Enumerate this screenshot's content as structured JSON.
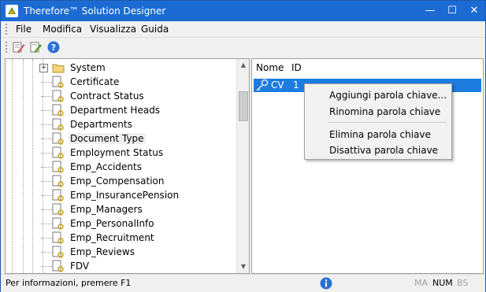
{
  "window": {
    "title": "Therefore™ Solution Designer",
    "minimize_glyph": "—",
    "maximize_glyph": "☐",
    "close_glyph": "✕"
  },
  "menubar": {
    "items": [
      "File",
      "Modifica",
      "Visualizza",
      "Guida"
    ]
  },
  "toolbar": {
    "buttons": [
      "edit-icon",
      "pencil-icon",
      "help-icon"
    ]
  },
  "tree": {
    "root_label": "System",
    "items": [
      "Certificate",
      "Contract Status",
      "Department Heads",
      "Departments",
      "Document Type",
      "Employment Status",
      "Emp_Accidents",
      "Emp_Compensation",
      "Emp_InsurancePension",
      "Emp_Managers",
      "Emp_PersonalInfo",
      "Emp_Recruitment",
      "Emp_Reviews",
      "FDV"
    ],
    "selected": "Document Type",
    "expander_glyph": "+"
  },
  "list": {
    "headers": [
      "Nome",
      "ID"
    ],
    "rows": [
      {
        "name": "CV",
        "id": "1"
      }
    ]
  },
  "context_menu": {
    "items": [
      "Aggiungi parola chiave...",
      "Rinomina parola chiave",
      "Elimina parola chiave",
      "Disattiva parola chiave"
    ]
  },
  "statusbar": {
    "text": "Per informazioni, premere F1",
    "indicators": [
      "MA",
      "NUM",
      "BS"
    ],
    "indicator_active": [
      false,
      true,
      false
    ]
  },
  "colors": {
    "titlebar": "#1c6bd4",
    "selection": "#1c7ce0"
  }
}
